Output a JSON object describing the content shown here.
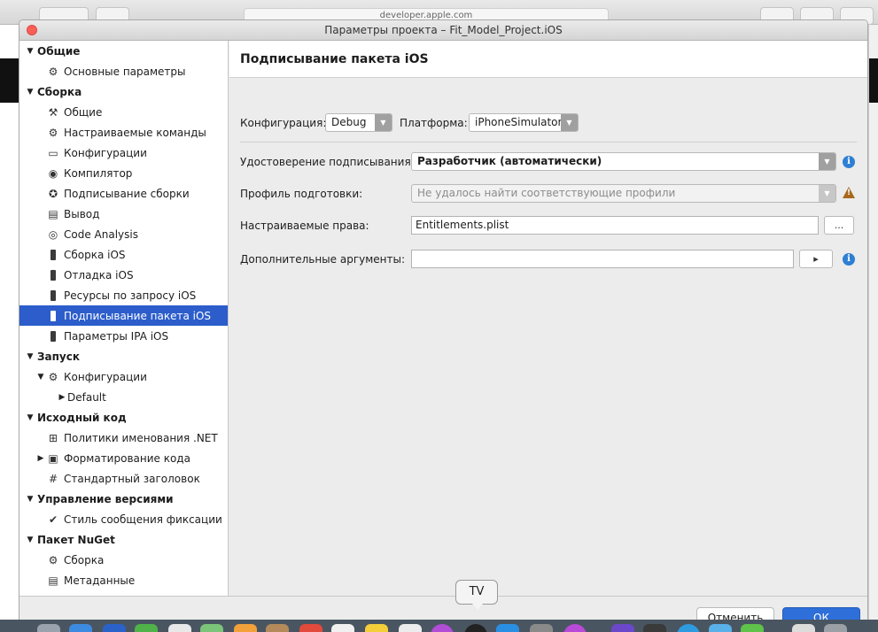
{
  "browser": {
    "url": "developer.apple.com"
  },
  "window": {
    "title": "Параметры проекта – Fit_Model_Project.iOS"
  },
  "sidebar": {
    "items": [
      {
        "label": "Общие",
        "level": 0,
        "head": true,
        "arrow": "down"
      },
      {
        "label": "Основные параметры",
        "level": 1,
        "icon": "⚙",
        "icon_name": "gear-icon"
      },
      {
        "label": "Сборка",
        "level": 0,
        "head": true,
        "arrow": "down"
      },
      {
        "label": "Общие",
        "level": 1,
        "icon": "⚒",
        "icon_name": "hammer-icon"
      },
      {
        "label": "Настраиваемые команды",
        "level": 1,
        "icon": "⚙",
        "icon_name": "gear-icon"
      },
      {
        "label": "Конфигурации",
        "level": 1,
        "icon": "▭",
        "icon_name": "window-icon"
      },
      {
        "label": "Компилятор",
        "level": 1,
        "icon": "◉",
        "icon_name": "compiler-icon"
      },
      {
        "label": "Подписывание сборки",
        "level": 1,
        "icon": "✪",
        "icon_name": "seal-icon"
      },
      {
        "label": "Вывод",
        "level": 1,
        "icon": "▤",
        "icon_name": "output-icon"
      },
      {
        "label": "Code Analysis",
        "level": 1,
        "icon": "◎",
        "icon_name": "target-icon"
      },
      {
        "label": "Сборка iOS",
        "level": 1,
        "icon": "phone",
        "icon_name": "iphone-icon"
      },
      {
        "label": "Отладка iOS",
        "level": 1,
        "icon": "phone",
        "icon_name": "iphone-icon"
      },
      {
        "label": "Ресурсы по запросу iOS",
        "level": 1,
        "icon": "phone",
        "icon_name": "iphone-icon"
      },
      {
        "label": "Подписывание пакета iOS",
        "level": 1,
        "icon": "phone",
        "icon_name": "iphone-icon",
        "selected": true
      },
      {
        "label": "Параметры IPA iOS",
        "level": 1,
        "icon": "phone",
        "icon_name": "iphone-icon"
      },
      {
        "label": "Запуск",
        "level": 0,
        "head": true,
        "arrow": "down"
      },
      {
        "label": "Конфигурации",
        "level": 1,
        "icon": "⚙",
        "icon_name": "gear-icon",
        "arrow": "down"
      },
      {
        "label": "Default",
        "level": 2,
        "arrow": "right"
      },
      {
        "label": "Исходный код",
        "level": 0,
        "head": true,
        "arrow": "down"
      },
      {
        "label": "Политики именования .NET",
        "level": 1,
        "icon": "⊞",
        "icon_name": "naming-icon"
      },
      {
        "label": "Форматирование кода",
        "level": 1,
        "icon": "▣",
        "icon_name": "format-icon",
        "arrow": "right"
      },
      {
        "label": "Стандартный заголовок",
        "level": 1,
        "icon": "#",
        "icon_name": "header-icon"
      },
      {
        "label": "Управление версиями",
        "level": 0,
        "head": true,
        "arrow": "down"
      },
      {
        "label": "Стиль сообщения фиксации",
        "level": 1,
        "icon": "✔",
        "icon_name": "check-circle-icon"
      },
      {
        "label": "Пакет NuGet",
        "level": 0,
        "head": true,
        "arrow": "down"
      },
      {
        "label": "Сборка",
        "level": 1,
        "icon": "⚙",
        "icon_name": "gear-icon"
      },
      {
        "label": "Метаданные",
        "level": 1,
        "icon": "▤",
        "icon_name": "metadata-icon"
      }
    ]
  },
  "panel": {
    "title": "Подписывание пакета iOS",
    "config_label": "Конфигурация:",
    "config_value": "Debug",
    "platform_label": "Платформа:",
    "platform_value": "iPhoneSimulator",
    "identity_label": "Удостоверение подписывания:",
    "identity_value": "Разработчик (автоматически)",
    "profile_label": "Профиль подготовки:",
    "profile_value": "Не удалось найти соответствующие профили",
    "entitlements_label": "Настраиваемые права:",
    "entitlements_value": "Entitlements.plist",
    "browse_label": "...",
    "args_label": "Дополнительные аргументы:",
    "args_value": "",
    "run_label": "▸"
  },
  "buttons": {
    "cancel": "Отменить",
    "ok": "ОК"
  },
  "tooltip": "TV",
  "colors": {
    "selection": "#2c5dcb",
    "info": "#2d7fd4",
    "warning": "#a6691c",
    "ok_button": "#2e6fd9",
    "close": "#fc5f57"
  }
}
